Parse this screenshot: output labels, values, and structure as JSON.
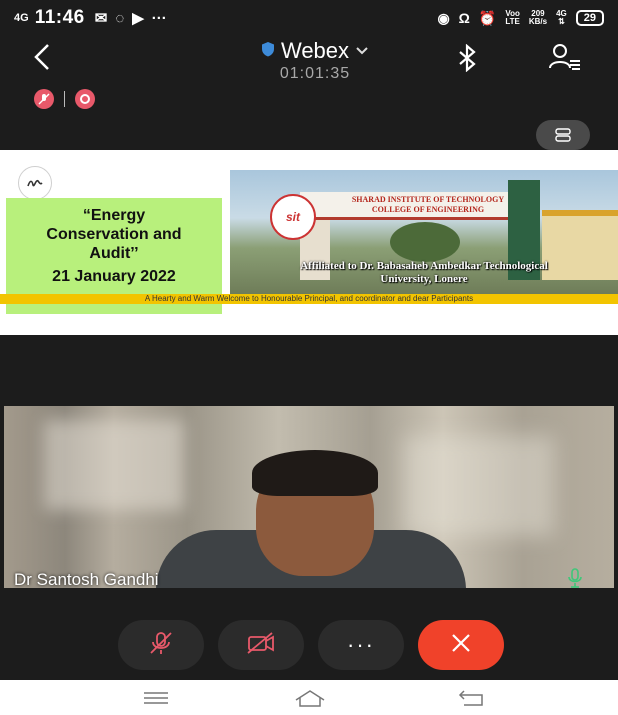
{
  "status_bar": {
    "signal": "4G",
    "time": "11:46",
    "net_type_top": "Voo",
    "net_type_bottom": "LTE",
    "speed_value": "209",
    "speed_unit": "KB/s",
    "data_top": "4G",
    "battery": "29"
  },
  "header": {
    "app_title": "Webex",
    "call_timer": "01:01:35"
  },
  "slide": {
    "event_title_line1": "“Energy",
    "event_title_line2": "Conservation  and",
    "event_title_line3": "Audit’’",
    "event_date": "21 January 2022",
    "college_line1": "SHARAD INSTITUTE OF TECHNOLOGY",
    "college_line2": "COLLEGE OF ENGINEERING",
    "logo_text": "sit",
    "affiliation_line1": "Affiliated to Dr. Babasaheb Ambedkar Technological",
    "affiliation_line2": "University, Lonere",
    "banner_text": "A Hearty and Warm Welcome to Honourable Principal, and coordinator and dear Participants"
  },
  "video": {
    "participant_name": "Dr Santosh Gandhi"
  },
  "colors": {
    "end_call": "#f0422a",
    "recording_dot": "#e8596a",
    "webex_shield": "#3d8bd9",
    "active_mic": "#3fc779",
    "event_box": "#b8f07c",
    "banner": "#f2c400"
  }
}
